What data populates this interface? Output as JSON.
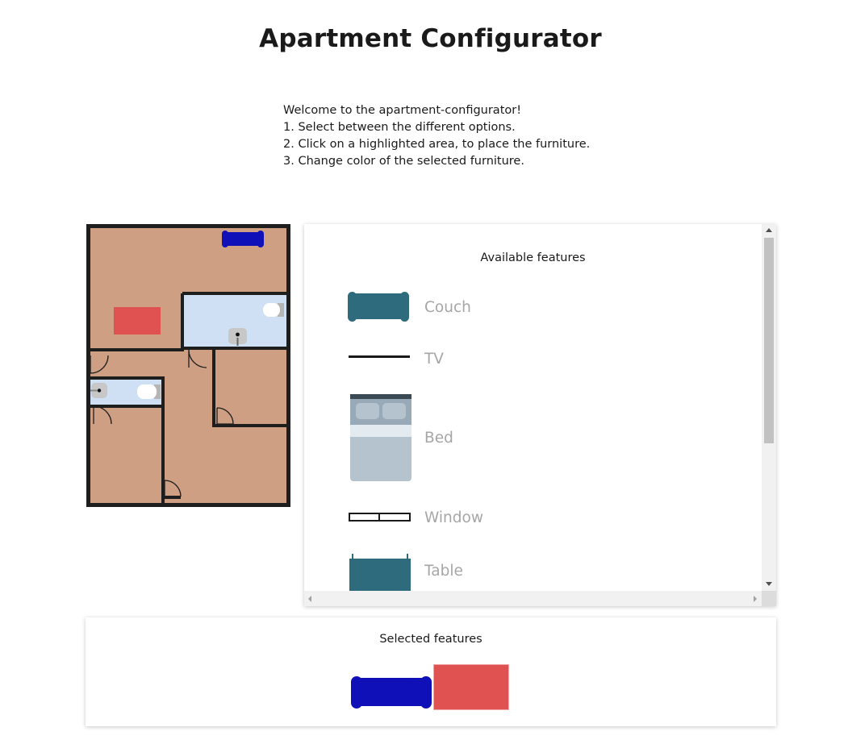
{
  "header": {
    "title": "Apartment Configurator"
  },
  "intro": {
    "lines": [
      "Welcome to the apartment-configurator!",
      "1. Select between the different options.",
      "2. Click on a highlighted area, to place the furniture.",
      "3. Change color of the selected furniture."
    ]
  },
  "features": {
    "heading": "Available features",
    "items": [
      {
        "label": "Couch",
        "icon": "couch-icon",
        "color": "#2d6b7d"
      },
      {
        "label": "TV",
        "icon": "tv-icon",
        "color": "#1a1a1a"
      },
      {
        "label": "Bed",
        "icon": "bed-icon",
        "color": "#b4c3cd"
      },
      {
        "label": "Window",
        "icon": "window-icon",
        "color": "#1a1a1a"
      },
      {
        "label": "Table",
        "icon": "table-icon",
        "color": "#2d6b7d"
      }
    ]
  },
  "selected": {
    "heading": "Selected features",
    "items": [
      {
        "type": "couch",
        "color": "#1010b8"
      },
      {
        "type": "carpet",
        "color": "#e05252"
      }
    ]
  },
  "floorplan": {
    "floor_color": "#cf9f83",
    "wall_color": "#1e1e1e",
    "bathroom_color": "#cfe0f5",
    "placed": [
      {
        "type": "couch",
        "color": "#1010b8"
      },
      {
        "type": "carpet",
        "color": "#e05252"
      }
    ]
  }
}
